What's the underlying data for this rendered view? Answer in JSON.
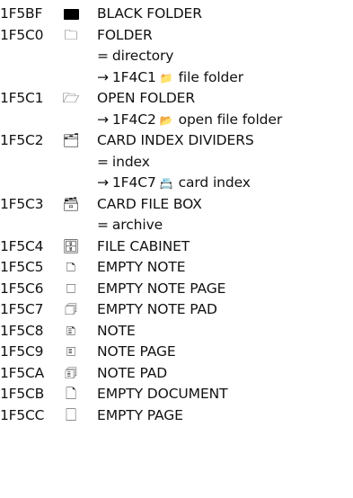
{
  "entries": [
    {
      "code": "1F5BF",
      "glyph": "",
      "glyph_icon": "black-folder-icon",
      "name": "BLACK FOLDER",
      "notes": []
    },
    {
      "code": "1F5C0",
      "glyph": "🗀",
      "glyph_icon": "folder-icon",
      "name": "FOLDER",
      "notes": [
        {
          "kind": "alias",
          "symbol": "=",
          "text": "directory"
        },
        {
          "kind": "xref",
          "symbol": "→",
          "code": "1F4C1",
          "glyph": "📁",
          "text": "file folder"
        }
      ]
    },
    {
      "code": "1F5C1",
      "glyph": "🗁",
      "glyph_icon": "open-folder-icon",
      "name": "OPEN FOLDER",
      "notes": [
        {
          "kind": "xref",
          "symbol": "→",
          "code": "1F4C2",
          "glyph": "📂",
          "text": "open file folder"
        }
      ]
    },
    {
      "code": "1F5C2",
      "glyph": "🗂",
      "glyph_icon": "card-index-dividers-icon",
      "name": "CARD INDEX DIVIDERS",
      "notes": [
        {
          "kind": "alias",
          "symbol": "=",
          "text": "index"
        },
        {
          "kind": "xref",
          "symbol": "→",
          "code": "1F4C7",
          "glyph": "📇",
          "text": "card index"
        }
      ]
    },
    {
      "code": "1F5C3",
      "glyph": "🗃",
      "glyph_icon": "card-file-box-icon",
      "name": "CARD FILE BOX",
      "notes": [
        {
          "kind": "alias",
          "symbol": "=",
          "text": "archive"
        }
      ]
    },
    {
      "code": "1F5C4",
      "glyph": "🗄",
      "glyph_icon": "file-cabinet-icon",
      "name": "FILE CABINET",
      "notes": []
    },
    {
      "code": "1F5C5",
      "glyph": "🗅",
      "glyph_icon": "empty-note-icon",
      "name": "EMPTY NOTE",
      "notes": []
    },
    {
      "code": "1F5C6",
      "glyph": "🗆",
      "glyph_icon": "empty-note-page-icon",
      "name": "EMPTY NOTE PAGE",
      "notes": []
    },
    {
      "code": "1F5C7",
      "glyph": "🗇",
      "glyph_icon": "empty-note-pad-icon",
      "name": "EMPTY NOTE PAD",
      "notes": []
    },
    {
      "code": "1F5C8",
      "glyph": "🗈",
      "glyph_icon": "note-icon",
      "name": "NOTE",
      "notes": []
    },
    {
      "code": "1F5C9",
      "glyph": "🗉",
      "glyph_icon": "note-page-icon",
      "name": "NOTE PAGE",
      "notes": []
    },
    {
      "code": "1F5CA",
      "glyph": "🗊",
      "glyph_icon": "note-pad-icon",
      "name": "NOTE PAD",
      "notes": []
    },
    {
      "code": "1F5CB",
      "glyph": "🗋",
      "glyph_icon": "empty-document-icon",
      "name": "EMPTY DOCUMENT",
      "notes": []
    },
    {
      "code": "1F5CC",
      "glyph": "🗌",
      "glyph_icon": "empty-page-icon",
      "name": "EMPTY PAGE",
      "notes": []
    }
  ]
}
